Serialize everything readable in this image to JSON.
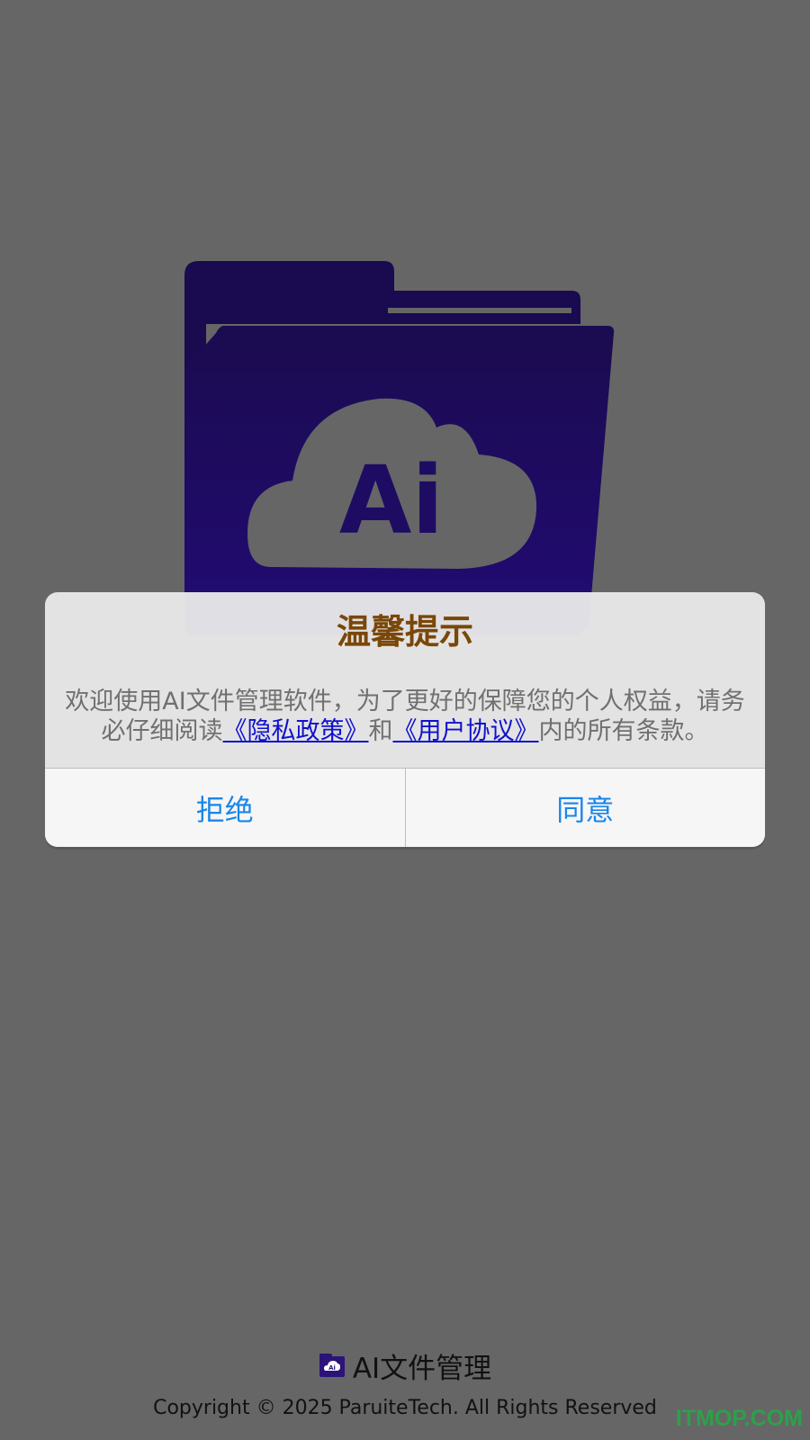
{
  "app": {
    "name": "AI文件管理",
    "logo_text": "Ai"
  },
  "dialog": {
    "title": "温馨提示",
    "message_parts": {
      "before": "欢迎使用AI文件管理软件，为了更好的保障您的个人权益，请务必仔细阅读",
      "privacy_link": "《隐私政策》",
      "middle": "和",
      "agreement_link": "《用户协议》",
      "after": "内的所有条款。"
    },
    "buttons": {
      "reject": "拒绝",
      "agree": "同意"
    }
  },
  "footer": {
    "app_label": "AI文件管理",
    "copyright": "Copyright © 2025 ParuiteTech. All Rights Reserved",
    "watermark": "ITMOP.COM"
  },
  "colors": {
    "background": "#666666",
    "logo_purple": "#1e0c63",
    "title_brown": "#7a4708",
    "button_blue": "#1a86e8",
    "link_blue": "#1010d0",
    "watermark_green": "#2da04a"
  },
  "icons": {
    "main_logo": "folder-cloud-ai-icon",
    "footer_logo": "folder-cloud-ai-icon"
  }
}
